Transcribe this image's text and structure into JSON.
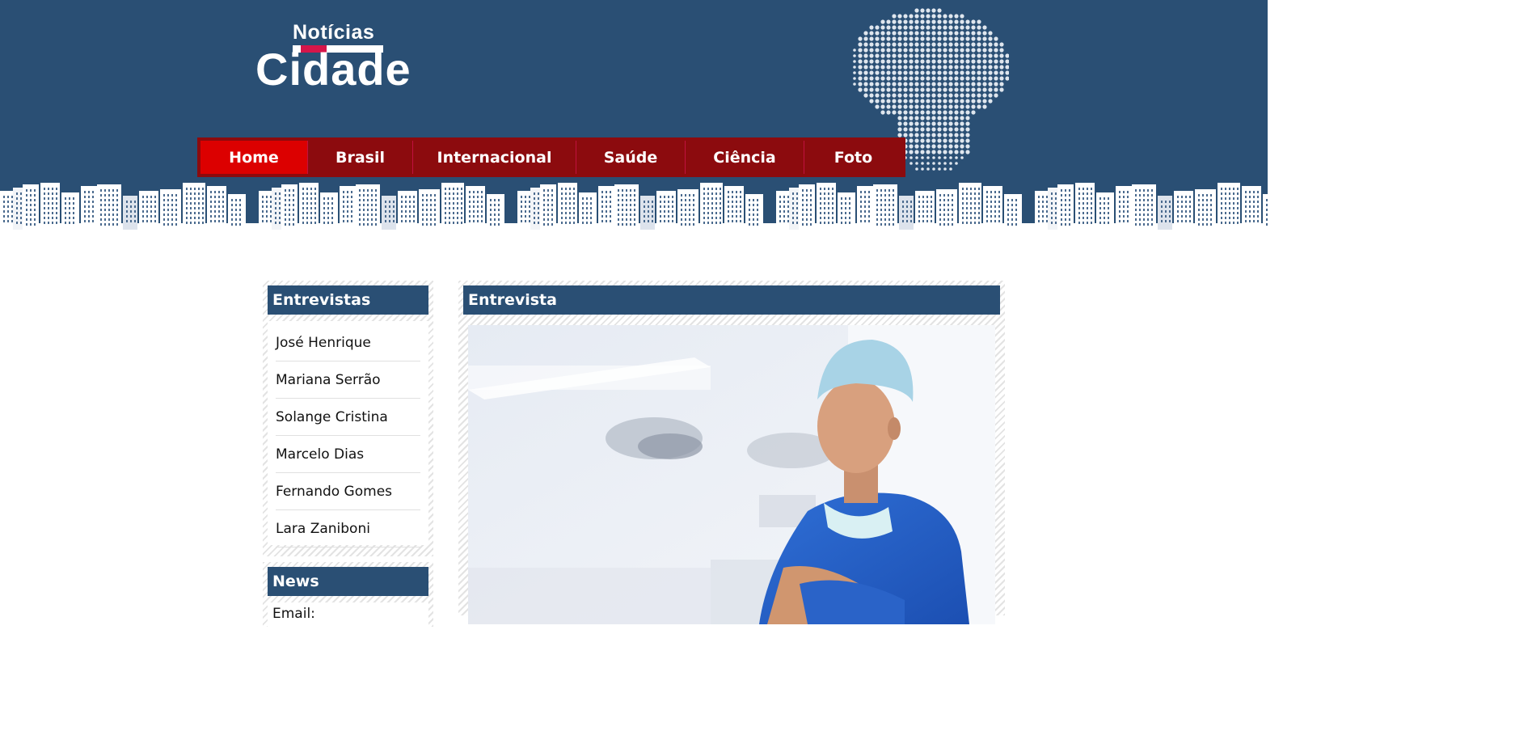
{
  "logo": {
    "top_text": "Notícias",
    "main_text": "Cidade"
  },
  "nav": {
    "items": [
      {
        "label": "Home",
        "active": true
      },
      {
        "label": "Brasil",
        "active": false
      },
      {
        "label": "Internacional",
        "active": false
      },
      {
        "label": "Saúde",
        "active": false
      },
      {
        "label": "Ciência",
        "active": false
      },
      {
        "label": "Foto",
        "active": false
      }
    ]
  },
  "sidebar": {
    "interviews_title": "Entrevistas",
    "interviews": [
      "José Henrique",
      "Mariana Serrão",
      "Solange Cristina",
      "Marcelo Dias",
      "Fernando Gomes",
      "Lara Zaniboni"
    ],
    "news_title": "News",
    "email_label": "Email:"
  },
  "main": {
    "title": "Entrevista"
  },
  "colors": {
    "header_bg": "#2a4f74",
    "nav_bg": "#8c0b0e",
    "nav_active": "#dc0000",
    "accent_logo": "#d6164a"
  }
}
